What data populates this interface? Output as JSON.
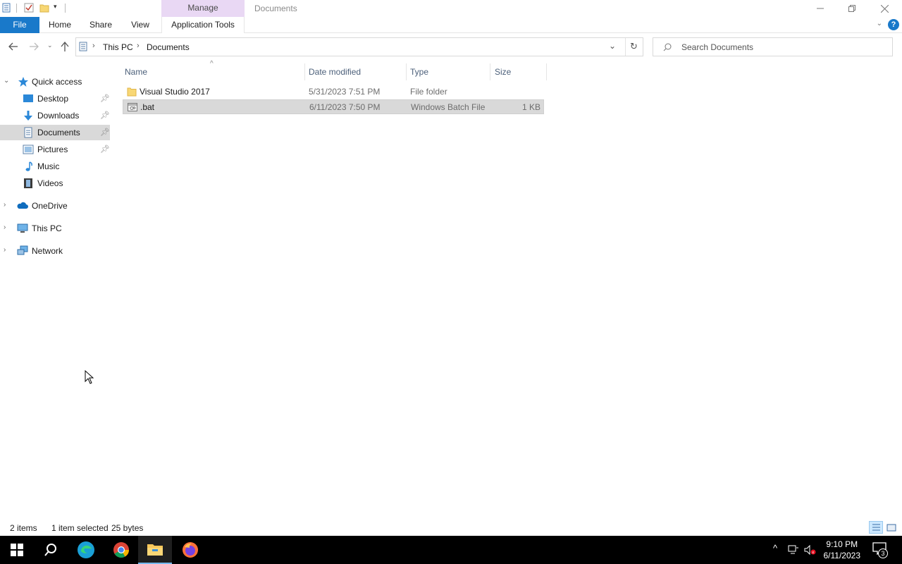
{
  "titlebar": {
    "contextual_tab": "Manage",
    "window_title": "Documents"
  },
  "ribbon": {
    "tabs": [
      "File",
      "Home",
      "Share",
      "View",
      "Application Tools"
    ]
  },
  "address": {
    "crumbs": [
      "This PC",
      "Documents"
    ]
  },
  "search": {
    "placeholder": "Search Documents"
  },
  "nav": {
    "quick_access": "Quick access",
    "pinned": [
      {
        "label": "Desktop",
        "icon": "desktop-icon",
        "pinned": true
      },
      {
        "label": "Downloads",
        "icon": "downloads-icon",
        "pinned": true
      },
      {
        "label": "Documents",
        "icon": "documents-icon",
        "pinned": true,
        "selected": true
      },
      {
        "label": "Pictures",
        "icon": "pictures-icon",
        "pinned": true
      },
      {
        "label": "Music",
        "icon": "music-icon",
        "pinned": false
      },
      {
        "label": "Videos",
        "icon": "videos-icon",
        "pinned": false
      }
    ],
    "roots": [
      "OneDrive",
      "This PC",
      "Network"
    ]
  },
  "columns": {
    "name": "Name",
    "date": "Date modified",
    "type": "Type",
    "size": "Size"
  },
  "files": [
    {
      "name": "Visual Studio 2017",
      "date": "5/31/2023 7:51 PM",
      "type": "File folder",
      "size": "",
      "icon": "folder-icon",
      "selected": false
    },
    {
      "name": ".bat",
      "date": "6/11/2023 7:50 PM",
      "type": "Windows Batch File",
      "size": "1 KB",
      "icon": "batch-file-icon",
      "selected": true
    }
  ],
  "status": {
    "count": "2 items",
    "selection": "1 item selected",
    "bytes": "25 bytes"
  },
  "taskbar": {
    "time": "9:10 PM",
    "date": "6/11/2023",
    "notifications": "3"
  },
  "colors": {
    "file_tab": "#1979ca",
    "manage_tab": "#e9d8f4",
    "selection": "#d9d9d9",
    "taskbar": "#000000"
  }
}
